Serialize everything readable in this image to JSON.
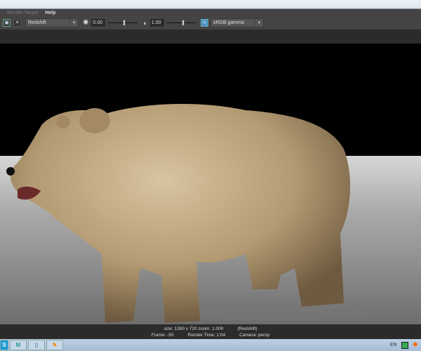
{
  "menu": {
    "items": [
      "Render Target",
      "Help"
    ]
  },
  "toolbar": {
    "renderer": "Redshift",
    "exposure": "0.00",
    "gamma": "1.00",
    "colorspace": "sRGB gamma",
    "exposure_level": 0.5,
    "gamma_level": 0.5
  },
  "status": {
    "size": "size: 1280 x 720 zoom: 1.000",
    "renderer": "(Redshift)",
    "frame": "Frame: -50",
    "render_time": "Render Time:  1:04",
    "camera": "Camera: persp"
  },
  "taskbar": {
    "lang": "EN",
    "apps": [
      "skype",
      "maya",
      "notepad",
      "paint"
    ]
  }
}
